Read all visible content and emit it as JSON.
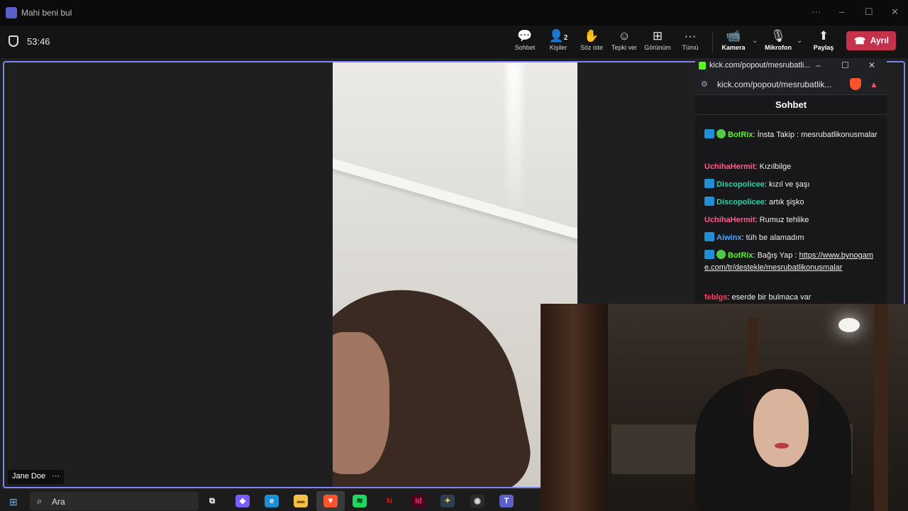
{
  "window": {
    "title": "Mahi beni bul",
    "controls": [
      "···",
      "–",
      "☐",
      "✕"
    ]
  },
  "toolbar": {
    "timer": "53:46",
    "buttons": [
      {
        "label": "Sohbet",
        "icon": "💬"
      },
      {
        "label": "Kişiler",
        "icon": "👤",
        "count": "2"
      },
      {
        "label": "Söz iste",
        "icon": "✋"
      },
      {
        "label": "Tepki ver",
        "icon": "☺"
      },
      {
        "label": "Görünüm",
        "icon": "⊞"
      },
      {
        "label": "Tümü",
        "icon": "···"
      },
      {
        "label": "Kamera",
        "icon": "📹"
      },
      {
        "label": "Mikrofon",
        "icon": "🎙"
      },
      {
        "label": "Paylaş",
        "icon": "⬆"
      }
    ],
    "leave_label": "Ayrıl"
  },
  "participant": {
    "name": "Jane Doe",
    "more": "···"
  },
  "browser": {
    "tab_title": "kick.com/popout/mesrubatli...",
    "url": "kick.com/popout/mesrubatlik...",
    "chat_header": "Sohbet",
    "messages": [
      {
        "user": "BotRix",
        "color": "#53fc18",
        "badge": true,
        "verified": true,
        "text": ": İnsta Takip : mesrubatlikonusmalar"
      },
      {
        "user": "UchihaHermit",
        "color": "#ff5c8a",
        "badge": false,
        "verified": false,
        "text": ": Kızılbilge"
      },
      {
        "user": "Discopolicee",
        "color": "#2cd4a3",
        "badge": true,
        "verified": false,
        "text": ": kızıl ve şaşı"
      },
      {
        "user": "Discopolicee",
        "color": "#2cd4a3",
        "badge": true,
        "verified": false,
        "text": ": artık şişko"
      },
      {
        "user": "UchihaHermit",
        "color": "#ff5c8a",
        "badge": false,
        "verified": false,
        "text": ": Rumuz tehlike"
      },
      {
        "user": "Aiwinx",
        "color": "#4aa3ff",
        "badge": true,
        "verified": false,
        "text": ": tüh be alamadım"
      },
      {
        "user": "BotRix",
        "color": "#53fc18",
        "badge": true,
        "verified": true,
        "text": ": Bağış Yap :",
        "link": "https://www.bynogame.com/tr/destekle/mesrubatlikonusmalar"
      },
      {
        "user": "feblgs",
        "color": "#ff3b5c",
        "badge": false,
        "verified": false,
        "text": ": eserde bir bulmaca var"
      }
    ]
  },
  "taskbar": {
    "search_placeholder": "Ara",
    "apps": [
      {
        "name": "task-view",
        "glyph": "⧉",
        "bg": "#1c1c1c",
        "fg": "#fff"
      },
      {
        "name": "copilot",
        "glyph": "◆",
        "bg": "#7a5cff",
        "fg": "#fff"
      },
      {
        "name": "edge",
        "glyph": "e",
        "bg": "#1d8fd6",
        "fg": "#fff"
      },
      {
        "name": "file-explorer",
        "glyph": "▬",
        "bg": "#f2c14a",
        "fg": "#8a5a00"
      },
      {
        "name": "brave",
        "glyph": "▼",
        "bg": "#fb542b",
        "fg": "#fff"
      },
      {
        "name": "spotify",
        "glyph": "≋",
        "bg": "#1ed760",
        "fg": "#111"
      },
      {
        "name": "netflix",
        "glyph": "N",
        "bg": "#1c1c1c",
        "fg": "#e50914"
      },
      {
        "name": "indesign",
        "glyph": "Id",
        "bg": "#49021f",
        "fg": "#ff3366"
      },
      {
        "name": "davinci",
        "glyph": "✦",
        "bg": "#2d3e50",
        "fg": "#f5c542"
      },
      {
        "name": "obs",
        "glyph": "◉",
        "bg": "#2a2a2a",
        "fg": "#ddd"
      },
      {
        "name": "teams",
        "glyph": "T",
        "bg": "#5b5fc7",
        "fg": "#fff"
      }
    ]
  }
}
